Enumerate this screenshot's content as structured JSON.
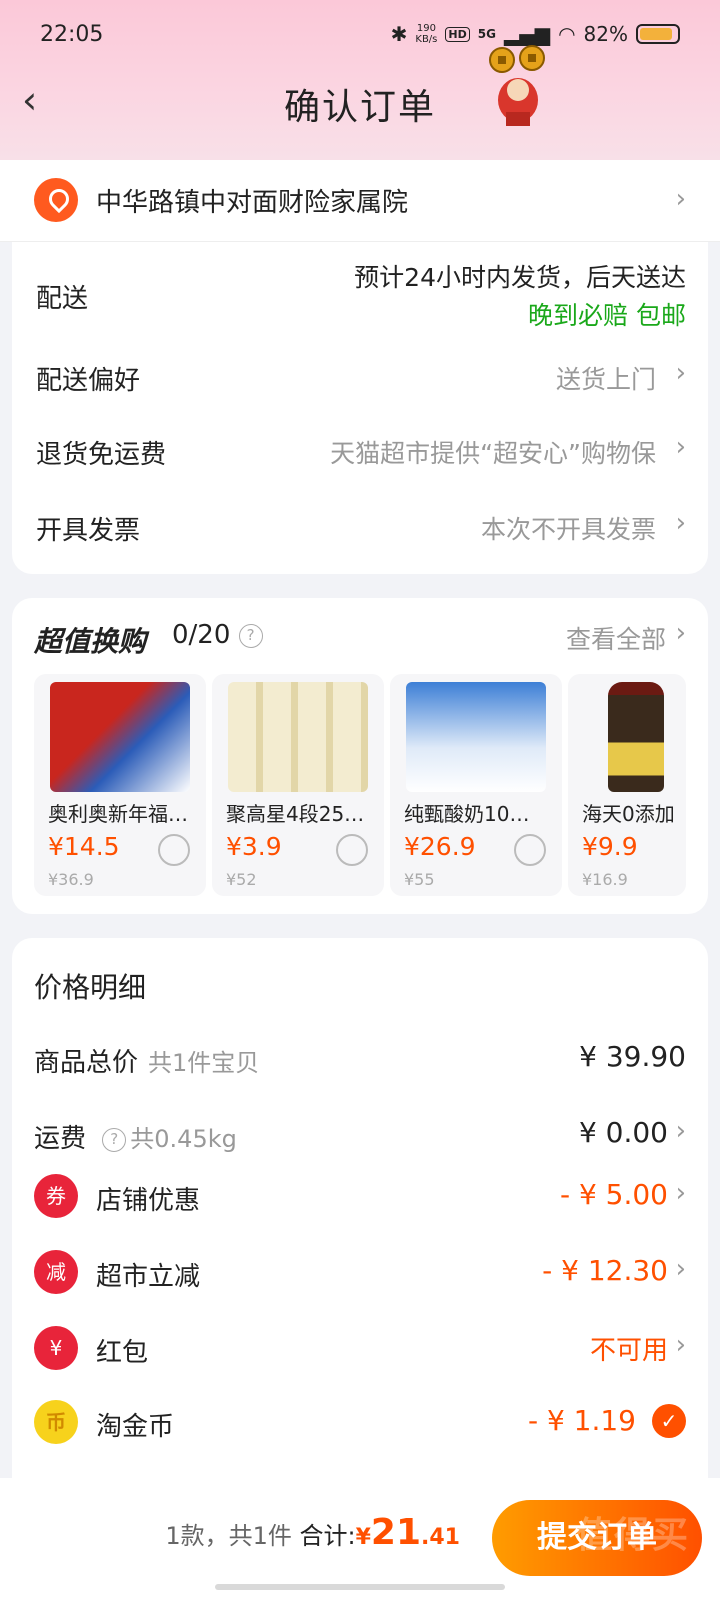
{
  "status_bar": {
    "time": "22:05",
    "speed": "190\nKB/s",
    "hd": "HD",
    "network": "5G",
    "battery": "82%"
  },
  "header": {
    "title": "确认订单"
  },
  "address": {
    "text": "中华路镇中对面财险家属院"
  },
  "delivery": {
    "rows": [
      {
        "label": "配送",
        "value": "预计24小时内发货，后天送达",
        "note": "晚到必赔 包邮"
      },
      {
        "label": "配送偏好",
        "value": "送货上门"
      },
      {
        "label": "退货免运费",
        "value": "天猫超市提供“超安心”购物保"
      },
      {
        "label": "开具发票",
        "value": "本次不开具发票"
      }
    ]
  },
  "trade_in": {
    "title": "超值换购",
    "count": "0/20",
    "view_all": "查看全部",
    "items": [
      {
        "name": "奥利奥新年福…",
        "price": "¥14.5",
        "old_price": "¥36.9",
        "img_color": "#c9261e"
      },
      {
        "name": "聚高星4段25…",
        "price": "¥3.9",
        "old_price": "¥52",
        "img_color": "#efe6c6"
      },
      {
        "name": "纯甄酸奶10…",
        "price": "¥26.9",
        "old_price": "¥55",
        "img_color": "#3d7fd6"
      },
      {
        "name": "海天0添加",
        "price": "¥9.9",
        "old_price": "¥16.9",
        "img_color": "#3a2a1c"
      }
    ]
  },
  "price_detail": {
    "title": "价格明细",
    "goods_total": {
      "label": "商品总价",
      "sub": "共1件宝贝",
      "value": "¥ 39.90"
    },
    "shipping": {
      "label": "运费",
      "sub": "共0.45kg",
      "value": "¥ 0.00"
    },
    "discounts": [
      {
        "icon": "券",
        "label": "店铺优惠",
        "value": "- ¥ 5.00"
      },
      {
        "icon": "减",
        "label": "超市立减",
        "value": "- ¥ 12.30"
      },
      {
        "icon": "¥",
        "label": "红包",
        "value": "不可用"
      },
      {
        "icon": "币",
        "label": "淘金币",
        "value": "- ¥ 1.19"
      }
    ]
  },
  "footer": {
    "count_text": "1款，共1件",
    "total_label": "合计:",
    "currency": "¥",
    "amount_int": "21",
    "amount_dec": ".41",
    "submit": "提交订单",
    "watermark": "值得买"
  },
  "colors": {
    "accent": "#ff5000",
    "green": "#1aa81a",
    "header_pink": "#fbc8d8"
  }
}
